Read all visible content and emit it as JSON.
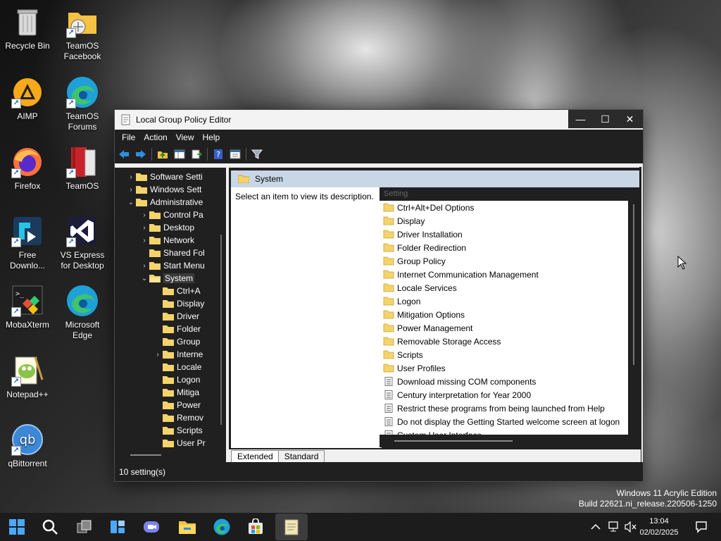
{
  "desktop": {
    "icons": [
      {
        "label": "Recycle Bin",
        "icon": "recycle-bin-icon"
      },
      {
        "label": "TeamOS Facebook",
        "icon": "folder-shortcut-icon"
      },
      {
        "label": "AIMP",
        "icon": "aimp-icon"
      },
      {
        "label": "TeamOS Forums",
        "icon": "edge-icon"
      },
      {
        "label": "Firefox",
        "icon": "firefox-icon"
      },
      {
        "label": "TeamOS",
        "icon": "teamos-book-icon"
      },
      {
        "label": "Free Downlo...",
        "icon": "free-download-manager-icon"
      },
      {
        "label": "VS Express for Desktop",
        "icon": "visual-studio-icon"
      },
      {
        "label": "MobaXterm",
        "icon": "mobaxterm-icon"
      },
      {
        "label": "Microsoft Edge",
        "icon": "edge-icon"
      },
      {
        "label": "Notepad++",
        "icon": "notepadpp-icon"
      },
      {
        "label": "qBittorrent",
        "icon": "qbittorrent-icon"
      }
    ]
  },
  "window": {
    "title": "Local Group Policy Editor",
    "controls": {
      "minimize": "—",
      "maximize": "☐",
      "close": "✕"
    },
    "menu": [
      "File",
      "Action",
      "View",
      "Help"
    ],
    "toolbar": [
      "back-icon",
      "forward-icon",
      "up-folder-icon",
      "show-hide-tree-icon",
      "export-list-icon",
      "help-icon",
      "properties-icon",
      "filter-icon"
    ],
    "tree": [
      {
        "label": "Software Setti",
        "expander": "›",
        "depth": 0
      },
      {
        "label": "Windows Sett",
        "expander": "›",
        "depth": 0
      },
      {
        "label": "Administrative",
        "expander": "⌄",
        "depth": 0
      },
      {
        "label": "Control Pa",
        "expander": "›",
        "depth": 1
      },
      {
        "label": "Desktop",
        "expander": "›",
        "depth": 1
      },
      {
        "label": "Network",
        "expander": "›",
        "depth": 1
      },
      {
        "label": "Shared Fol",
        "expander": "",
        "depth": 1
      },
      {
        "label": "Start Menu",
        "expander": "›",
        "depth": 1
      },
      {
        "label": "System",
        "expander": "⌄",
        "depth": 1,
        "selected": true
      },
      {
        "label": "Ctrl+A",
        "expander": "",
        "depth": 2
      },
      {
        "label": "Display",
        "expander": "",
        "depth": 2
      },
      {
        "label": "Driver",
        "expander": "",
        "depth": 2
      },
      {
        "label": "Folder",
        "expander": "",
        "depth": 2
      },
      {
        "label": "Group",
        "expander": "",
        "depth": 2
      },
      {
        "label": "Interne",
        "expander": "›",
        "depth": 2
      },
      {
        "label": "Locale",
        "expander": "",
        "depth": 2
      },
      {
        "label": "Logon",
        "expander": "",
        "depth": 2
      },
      {
        "label": "Mitiga",
        "expander": "",
        "depth": 2
      },
      {
        "label": "Power",
        "expander": "",
        "depth": 2
      },
      {
        "label": "Remov",
        "expander": "",
        "depth": 2
      },
      {
        "label": "Scripts",
        "expander": "",
        "depth": 2
      },
      {
        "label": "User Pr",
        "expander": "",
        "depth": 2
      }
    ],
    "right_header": "System",
    "description": "Select an item to view its description.",
    "list_header": "Setting",
    "list": [
      {
        "label": "Ctrl+Alt+Del Options",
        "type": "folder"
      },
      {
        "label": "Display",
        "type": "folder"
      },
      {
        "label": "Driver Installation",
        "type": "folder"
      },
      {
        "label": "Folder Redirection",
        "type": "folder"
      },
      {
        "label": "Group Policy",
        "type": "folder"
      },
      {
        "label": "Internet Communication Management",
        "type": "folder"
      },
      {
        "label": "Locale Services",
        "type": "folder"
      },
      {
        "label": "Logon",
        "type": "folder"
      },
      {
        "label": "Mitigation Options",
        "type": "folder"
      },
      {
        "label": "Power Management",
        "type": "folder"
      },
      {
        "label": "Removable Storage Access",
        "type": "folder"
      },
      {
        "label": "Scripts",
        "type": "folder"
      },
      {
        "label": "User Profiles",
        "type": "folder"
      },
      {
        "label": "Download missing COM components",
        "type": "setting"
      },
      {
        "label": "Century interpretation for Year 2000",
        "type": "setting"
      },
      {
        "label": "Restrict these programs from being launched from Help",
        "type": "setting"
      },
      {
        "label": "Do not display the Getting Started welcome screen at logon",
        "type": "setting"
      },
      {
        "label": "Custom User Interface",
        "type": "setting"
      }
    ],
    "tabs": [
      "Extended",
      "Standard"
    ],
    "status": "10 setting(s)"
  },
  "watermark": {
    "line1": "Windows 11 Acrylic Edition",
    "line2": "Build 22621.ni_release.220506-1250"
  },
  "taskbar": {
    "icons": [
      "start-icon",
      "search-icon",
      "task-view-icon",
      "widgets-icon",
      "teams-chat-icon",
      "file-explorer-icon",
      "edge-icon",
      "store-icon",
      "notepad-icon"
    ],
    "tray": [
      "chevron-up-icon",
      "network-icon",
      "volume-muted-icon"
    ],
    "time": "13:04",
    "date": "02/02/2025",
    "notification_icon": "notification-icon"
  }
}
